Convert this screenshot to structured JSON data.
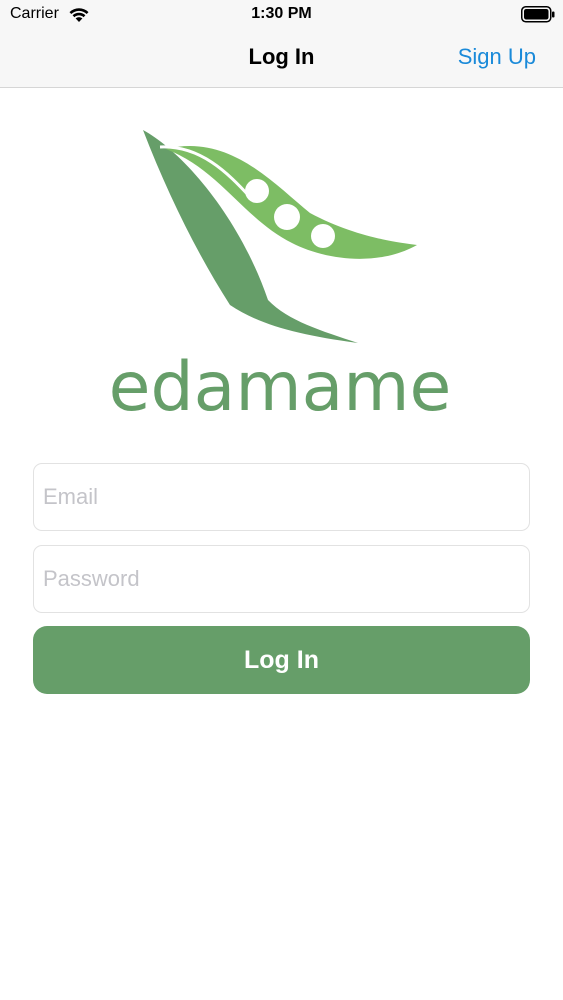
{
  "status_bar": {
    "carrier": "Carrier",
    "time": "1:30 PM",
    "wifi_icon": "wifi-icon",
    "battery_icon": "battery-icon"
  },
  "nav": {
    "title": "Log In",
    "right_action": "Sign Up"
  },
  "logo": {
    "wordmark": "edamame",
    "icon": "edamame-pod-logo"
  },
  "form": {
    "email_placeholder": "Email",
    "email_value": "",
    "password_placeholder": "Password",
    "password_value": "",
    "submit_label": "Log In"
  },
  "colors": {
    "brand_green": "#669e69",
    "light_green": "#7dbd64",
    "link_blue": "#1a8ad9"
  }
}
